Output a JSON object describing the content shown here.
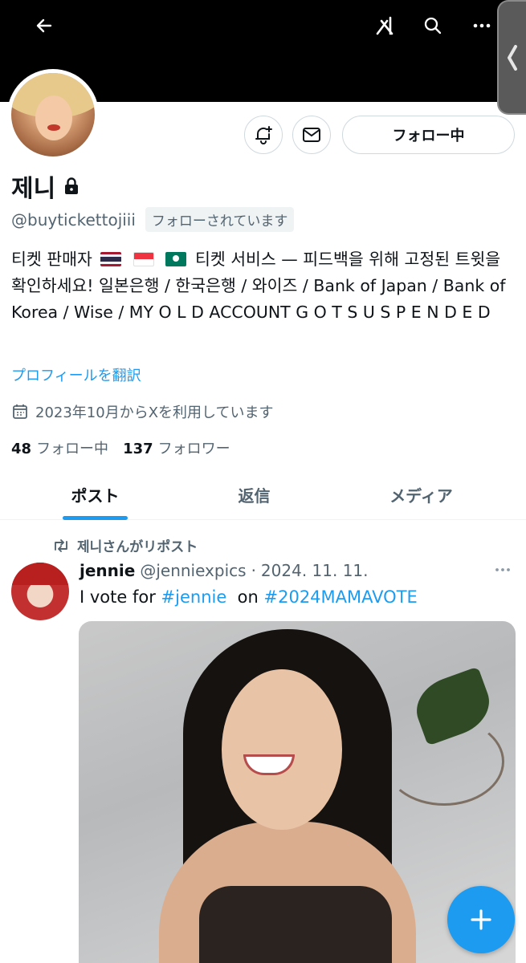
{
  "header": {
    "back_icon": "arrow-left-icon",
    "logo_icon": "x-grok-icon",
    "search_icon": "search-icon",
    "more_icon": "more-horizontal-icon",
    "side_handle_icon": "chevron-left-icon"
  },
  "profile": {
    "name": "제니",
    "handle": "@buytickettojiii",
    "follows_you": "フォローされています",
    "follow_button_label": "フォロー中",
    "bio": {
      "part1": "티켓 판매자",
      "part2": "티켓 서비스 — 피드백을 위해 고정된 트윗을 확인하세요! 일본은행 / 한국은행 / 와이즈 / Bank of Japan / Bank of Korea / Wise / MY O L D ACCOUNT G O T S U S P E N D E D"
    },
    "translate_label": "プロフィールを翻訳",
    "joined": "2023年10月からXを利用しています",
    "following_count": "48",
    "following_label": "フォロー中",
    "followers_count": "137",
    "followers_label": "フォロワー"
  },
  "tabs": [
    {
      "label": "ポスト",
      "active": true
    },
    {
      "label": "返信",
      "active": false
    },
    {
      "label": "メディア",
      "active": false
    }
  ],
  "post": {
    "repost_label": "제니さんがリポスト",
    "author_name": "jennie",
    "author_handle": "@jenniexpics",
    "separator": "·",
    "date": "2024. 11. 11.",
    "text_prefix": "I vote for",
    "tag1": "#jennie",
    "text_mid": "on",
    "tag2": "#2024MAMAVOTE"
  },
  "colors": {
    "accent": "#1d9bf0",
    "text_secondary": "#536471",
    "banner": "#000000"
  }
}
